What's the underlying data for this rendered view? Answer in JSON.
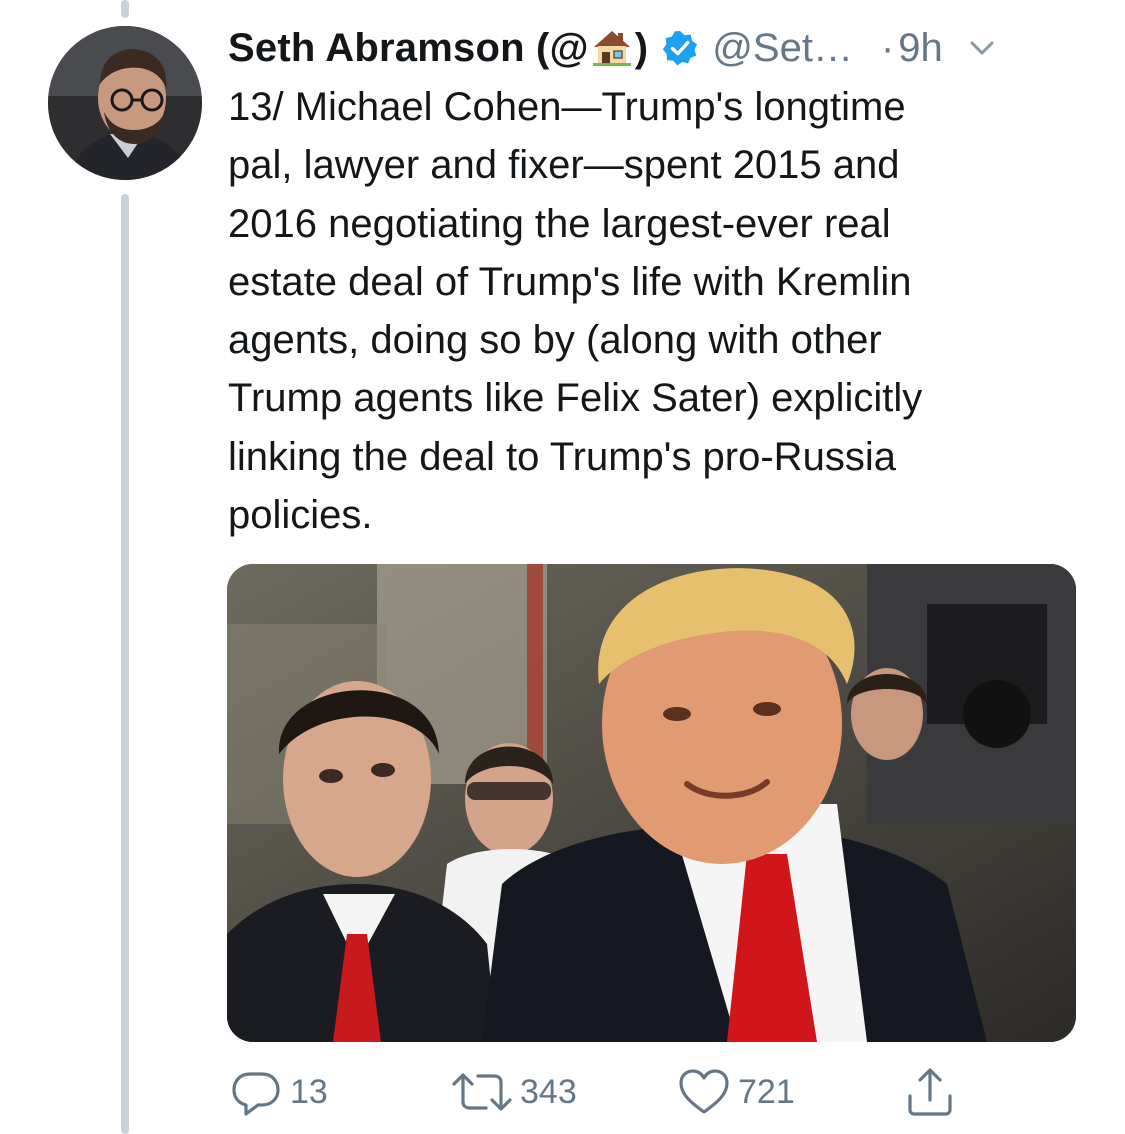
{
  "tweet": {
    "author": {
      "name_prefix": "Seth Abramson (@",
      "name_suffix": ")",
      "handle": "@Set…",
      "verified": true,
      "avatar_icon": "profile-photo"
    },
    "separator": "·",
    "timestamp": "9h",
    "text_lines": [
      "13/ Michael Cohen—Trump's longtime",
      "pal, lawyer and fixer—spent 2015 and",
      "2016 negotiating the largest-ever real",
      "estate deal of Trump's life with Kremlin",
      "agents, doing so by (along with other",
      "Trump agents like Felix Sater) explicitly",
      "linking the deal to Trump's pro-Russia",
      "policies."
    ],
    "media": {
      "type": "photo"
    },
    "actions": {
      "reply_count": "13",
      "retweet_count": "343",
      "like_count": "721"
    }
  },
  "colors": {
    "text_primary": "#14171a",
    "text_secondary": "#657786",
    "verified_blue": "#1da1f2",
    "thread_line": "#c9d3dc"
  },
  "icons": {
    "house": "house-emoji-icon",
    "verified": "verified-badge-icon",
    "chevron": "chevron-down-icon",
    "reply": "reply-icon",
    "retweet": "retweet-icon",
    "like": "heart-icon",
    "share": "share-icon"
  }
}
